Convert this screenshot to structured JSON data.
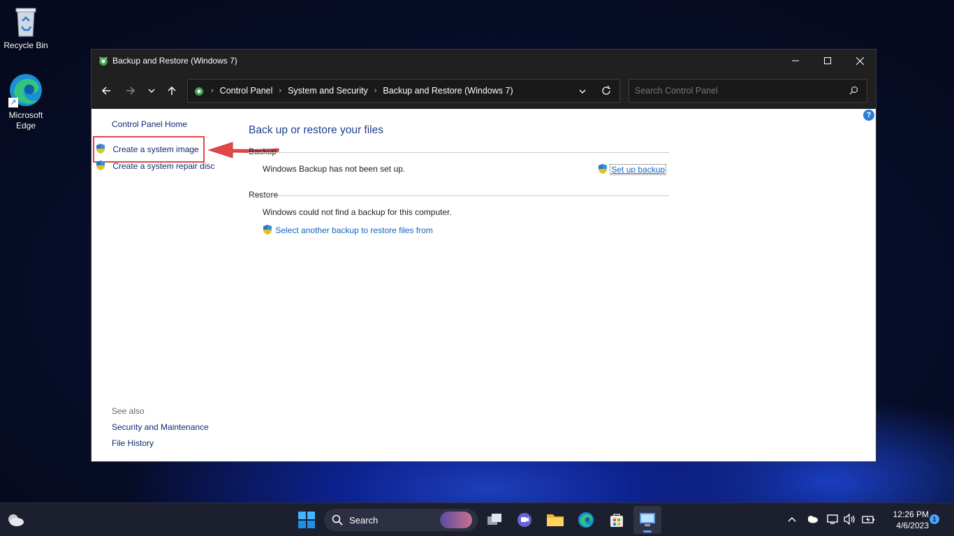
{
  "desktop": {
    "icons": [
      {
        "label": "Recycle Bin",
        "icon": "recycle-bin-icon"
      },
      {
        "label": "Microsoft Edge",
        "icon": "edge-icon"
      }
    ]
  },
  "window": {
    "title": "Backup and Restore (Windows 7)",
    "breadcrumb": [
      "Control Panel",
      "System and Security",
      "Backup and Restore (Windows 7)"
    ],
    "search_placeholder": "Search Control Panel"
  },
  "sidebar": {
    "home": "Control Panel Home",
    "tasks": [
      "Create a system image",
      "Create a system repair disc"
    ],
    "see_also_heading": "See also",
    "see_also": [
      "Security and Maintenance",
      "File History"
    ]
  },
  "main": {
    "heading": "Back up or restore your files",
    "backup": {
      "section": "Backup",
      "status": "Windows Backup has not been set up.",
      "action": "Set up backup"
    },
    "restore": {
      "section": "Restore",
      "status": "Windows could not find a backup for this computer.",
      "action": "Select another backup to restore files from"
    }
  },
  "taskbar": {
    "search_label": "Search",
    "time": "12:26 PM",
    "date": "4/6/2023",
    "notification_count": "1"
  },
  "colors": {
    "highlight": "#e04848",
    "link": "#1565c0",
    "heading": "#1e3e8c"
  }
}
